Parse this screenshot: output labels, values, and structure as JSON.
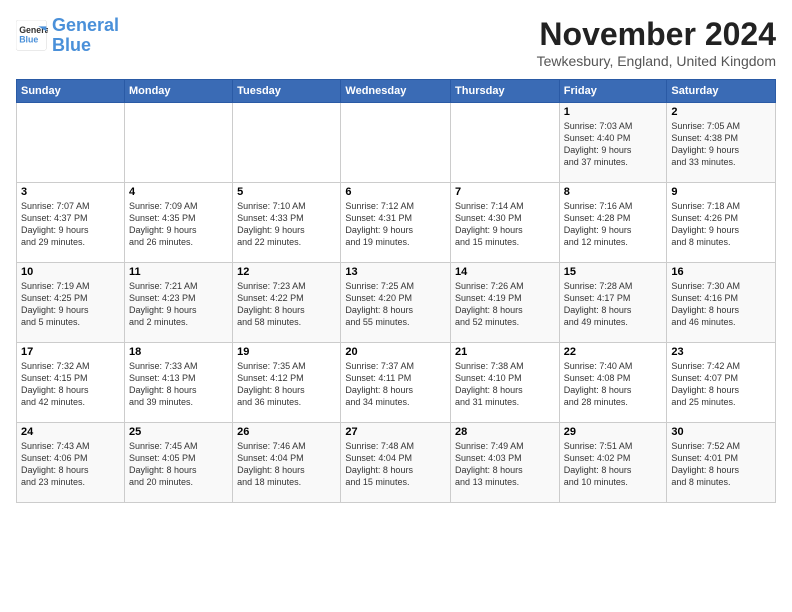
{
  "logo": {
    "line1": "General",
    "line2": "Blue"
  },
  "title": "November 2024",
  "location": "Tewkesbury, England, United Kingdom",
  "headers": [
    "Sunday",
    "Monday",
    "Tuesday",
    "Wednesday",
    "Thursday",
    "Friday",
    "Saturday"
  ],
  "weeks": [
    [
      {
        "day": "",
        "info": ""
      },
      {
        "day": "",
        "info": ""
      },
      {
        "day": "",
        "info": ""
      },
      {
        "day": "",
        "info": ""
      },
      {
        "day": "",
        "info": ""
      },
      {
        "day": "1",
        "info": "Sunrise: 7:03 AM\nSunset: 4:40 PM\nDaylight: 9 hours\nand 37 minutes."
      },
      {
        "day": "2",
        "info": "Sunrise: 7:05 AM\nSunset: 4:38 PM\nDaylight: 9 hours\nand 33 minutes."
      }
    ],
    [
      {
        "day": "3",
        "info": "Sunrise: 7:07 AM\nSunset: 4:37 PM\nDaylight: 9 hours\nand 29 minutes."
      },
      {
        "day": "4",
        "info": "Sunrise: 7:09 AM\nSunset: 4:35 PM\nDaylight: 9 hours\nand 26 minutes."
      },
      {
        "day": "5",
        "info": "Sunrise: 7:10 AM\nSunset: 4:33 PM\nDaylight: 9 hours\nand 22 minutes."
      },
      {
        "day": "6",
        "info": "Sunrise: 7:12 AM\nSunset: 4:31 PM\nDaylight: 9 hours\nand 19 minutes."
      },
      {
        "day": "7",
        "info": "Sunrise: 7:14 AM\nSunset: 4:30 PM\nDaylight: 9 hours\nand 15 minutes."
      },
      {
        "day": "8",
        "info": "Sunrise: 7:16 AM\nSunset: 4:28 PM\nDaylight: 9 hours\nand 12 minutes."
      },
      {
        "day": "9",
        "info": "Sunrise: 7:18 AM\nSunset: 4:26 PM\nDaylight: 9 hours\nand 8 minutes."
      }
    ],
    [
      {
        "day": "10",
        "info": "Sunrise: 7:19 AM\nSunset: 4:25 PM\nDaylight: 9 hours\nand 5 minutes."
      },
      {
        "day": "11",
        "info": "Sunrise: 7:21 AM\nSunset: 4:23 PM\nDaylight: 9 hours\nand 2 minutes."
      },
      {
        "day": "12",
        "info": "Sunrise: 7:23 AM\nSunset: 4:22 PM\nDaylight: 8 hours\nand 58 minutes."
      },
      {
        "day": "13",
        "info": "Sunrise: 7:25 AM\nSunset: 4:20 PM\nDaylight: 8 hours\nand 55 minutes."
      },
      {
        "day": "14",
        "info": "Sunrise: 7:26 AM\nSunset: 4:19 PM\nDaylight: 8 hours\nand 52 minutes."
      },
      {
        "day": "15",
        "info": "Sunrise: 7:28 AM\nSunset: 4:17 PM\nDaylight: 8 hours\nand 49 minutes."
      },
      {
        "day": "16",
        "info": "Sunrise: 7:30 AM\nSunset: 4:16 PM\nDaylight: 8 hours\nand 46 minutes."
      }
    ],
    [
      {
        "day": "17",
        "info": "Sunrise: 7:32 AM\nSunset: 4:15 PM\nDaylight: 8 hours\nand 42 minutes."
      },
      {
        "day": "18",
        "info": "Sunrise: 7:33 AM\nSunset: 4:13 PM\nDaylight: 8 hours\nand 39 minutes."
      },
      {
        "day": "19",
        "info": "Sunrise: 7:35 AM\nSunset: 4:12 PM\nDaylight: 8 hours\nand 36 minutes."
      },
      {
        "day": "20",
        "info": "Sunrise: 7:37 AM\nSunset: 4:11 PM\nDaylight: 8 hours\nand 34 minutes."
      },
      {
        "day": "21",
        "info": "Sunrise: 7:38 AM\nSunset: 4:10 PM\nDaylight: 8 hours\nand 31 minutes."
      },
      {
        "day": "22",
        "info": "Sunrise: 7:40 AM\nSunset: 4:08 PM\nDaylight: 8 hours\nand 28 minutes."
      },
      {
        "day": "23",
        "info": "Sunrise: 7:42 AM\nSunset: 4:07 PM\nDaylight: 8 hours\nand 25 minutes."
      }
    ],
    [
      {
        "day": "24",
        "info": "Sunrise: 7:43 AM\nSunset: 4:06 PM\nDaylight: 8 hours\nand 23 minutes."
      },
      {
        "day": "25",
        "info": "Sunrise: 7:45 AM\nSunset: 4:05 PM\nDaylight: 8 hours\nand 20 minutes."
      },
      {
        "day": "26",
        "info": "Sunrise: 7:46 AM\nSunset: 4:04 PM\nDaylight: 8 hours\nand 18 minutes."
      },
      {
        "day": "27",
        "info": "Sunrise: 7:48 AM\nSunset: 4:04 PM\nDaylight: 8 hours\nand 15 minutes."
      },
      {
        "day": "28",
        "info": "Sunrise: 7:49 AM\nSunset: 4:03 PM\nDaylight: 8 hours\nand 13 minutes."
      },
      {
        "day": "29",
        "info": "Sunrise: 7:51 AM\nSunset: 4:02 PM\nDaylight: 8 hours\nand 10 minutes."
      },
      {
        "day": "30",
        "info": "Sunrise: 7:52 AM\nSunset: 4:01 PM\nDaylight: 8 hours\nand 8 minutes."
      }
    ]
  ]
}
